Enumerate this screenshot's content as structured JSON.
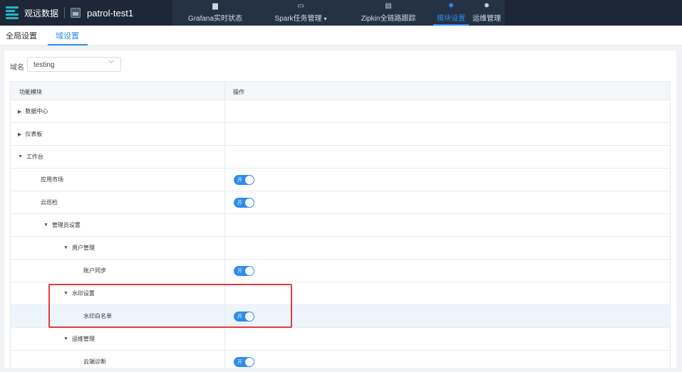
{
  "header": {
    "brand": "观远数据",
    "app_name": "patrol-test1",
    "nav": [
      {
        "label": "Grafana实时状态",
        "icon": "bar-chart-icon",
        "glyph": "▆"
      },
      {
        "label": "Spark任务管理",
        "icon": "monitor-icon",
        "glyph": "▭"
      },
      {
        "label": "Zipkin全链路跟踪",
        "icon": "document-icon",
        "glyph": "▤"
      },
      {
        "label": "模块设置",
        "icon": "gear-icon",
        "glyph": "✹",
        "active": true
      },
      {
        "label": "运维管理",
        "icon": "gear-icon",
        "glyph": "✹"
      }
    ]
  },
  "subtabs": [
    {
      "label": "全局设置"
    },
    {
      "label": "域设置",
      "active": true
    }
  ],
  "filter": {
    "label": "域名",
    "value": "testing"
  },
  "table": {
    "headers": {
      "name": "功能模块",
      "op": "操作"
    },
    "switch_on_text": "开",
    "rows": [
      {
        "label": "数据中心",
        "expand": "collapsed",
        "switch": false
      },
      {
        "label": "仪表板",
        "expand": "collapsed",
        "switch": false
      },
      {
        "label": "工作台",
        "expand": "expanded",
        "switch": false
      },
      {
        "label": "应用市场",
        "expand": "none",
        "switch": true
      },
      {
        "label": "云巡检",
        "expand": "none",
        "switch": true
      },
      {
        "label": "管理员设置",
        "expand": "expanded",
        "switch": false
      },
      {
        "label": "用户管理",
        "expand": "expanded",
        "switch": false
      },
      {
        "label": "账户同步",
        "expand": "none",
        "switch": true
      },
      {
        "label": "水印设置",
        "expand": "expanded",
        "switch": false
      },
      {
        "label": "水印白名单",
        "expand": "none",
        "switch": true,
        "highlight": true
      },
      {
        "label": "运维管理",
        "expand": "expanded",
        "switch": false
      },
      {
        "label": "云端诊断",
        "expand": "none",
        "switch": true
      }
    ]
  },
  "colors": {
    "accent": "#2d8cf0",
    "topbar": "#1d2737",
    "highlight_box": "#e53a3a"
  }
}
